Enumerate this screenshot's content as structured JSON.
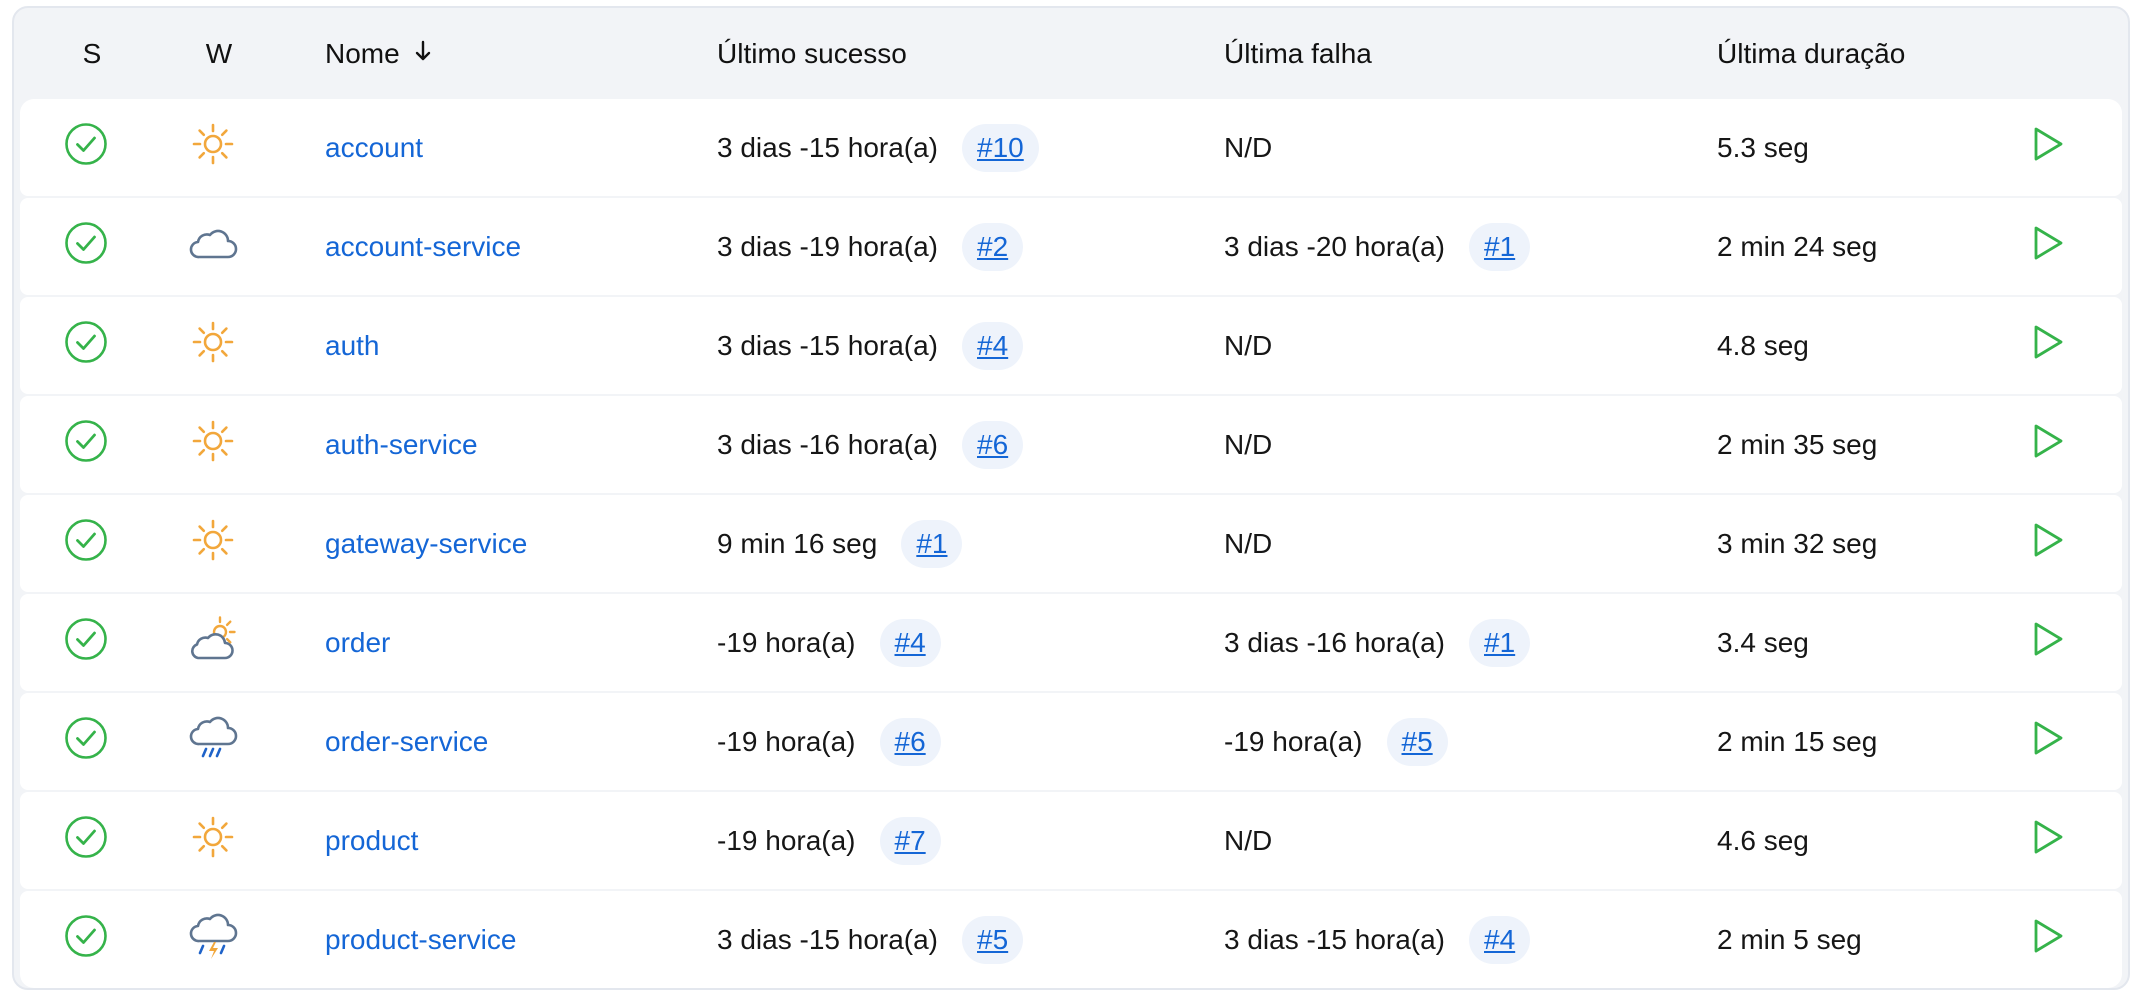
{
  "columns": {
    "status": "S",
    "weather": "W",
    "name": "Nome",
    "last_success": "Último sucesso",
    "last_failure": "Última falha",
    "last_duration": "Última duração"
  },
  "colors": {
    "link": "#1466d6",
    "success": "#35b34a",
    "sun": "#f2a73b",
    "cloud": "#5f7590",
    "rain": "#1f63c9",
    "badge_bg": "#eef3fb"
  },
  "jobs": [
    {
      "name": "account",
      "status_icon": "success-check-icon",
      "weather_icon": "sunny-icon",
      "last_success": "3 dias -15 hora(a)",
      "last_success_build": "#10",
      "last_failure": "N/D",
      "last_failure_build": "",
      "last_duration": "5.3 seg"
    },
    {
      "name": "account-service",
      "status_icon": "success-check-icon",
      "weather_icon": "cloudy-icon",
      "last_success": "3 dias -19 hora(a)",
      "last_success_build": "#2",
      "last_failure": "3 dias -20 hora(a)",
      "last_failure_build": "#1",
      "last_duration": "2 min 24 seg"
    },
    {
      "name": "auth",
      "status_icon": "success-check-icon",
      "weather_icon": "sunny-icon",
      "last_success": "3 dias -15 hora(a)",
      "last_success_build": "#4",
      "last_failure": "N/D",
      "last_failure_build": "",
      "last_duration": "4.8 seg"
    },
    {
      "name": "auth-service",
      "status_icon": "success-check-icon",
      "weather_icon": "sunny-icon",
      "last_success": "3 dias -16 hora(a)",
      "last_success_build": "#6",
      "last_failure": "N/D",
      "last_failure_build": "",
      "last_duration": "2 min 35 seg"
    },
    {
      "name": "gateway-service",
      "status_icon": "success-check-icon",
      "weather_icon": "sunny-icon",
      "last_success": "9 min 16 seg",
      "last_success_build": "#1",
      "last_failure": "N/D",
      "last_failure_build": "",
      "last_duration": "3 min 32 seg"
    },
    {
      "name": "order",
      "status_icon": "success-check-icon",
      "weather_icon": "partly-cloudy-icon",
      "last_success": "-19 hora(a)",
      "last_success_build": "#4",
      "last_failure": "3 dias -16 hora(a)",
      "last_failure_build": "#1",
      "last_duration": "3.4 seg"
    },
    {
      "name": "order-service",
      "status_icon": "success-check-icon",
      "weather_icon": "rainy-icon",
      "last_success": "-19 hora(a)",
      "last_success_build": "#6",
      "last_failure": "-19 hora(a)",
      "last_failure_build": "#5",
      "last_duration": "2 min 15 seg"
    },
    {
      "name": "product",
      "status_icon": "success-check-icon",
      "weather_icon": "sunny-icon",
      "last_success": "-19 hora(a)",
      "last_success_build": "#7",
      "last_failure": "N/D",
      "last_failure_build": "",
      "last_duration": "4.6 seg"
    },
    {
      "name": "product-service",
      "status_icon": "success-check-icon",
      "weather_icon": "thunderstorm-icon",
      "last_success": "3 dias -15 hora(a)",
      "last_success_build": "#5",
      "last_failure": "3 dias -15 hora(a)",
      "last_failure_build": "#4",
      "last_duration": "2 min 5 seg"
    }
  ],
  "row_action_icon": "play-icon"
}
